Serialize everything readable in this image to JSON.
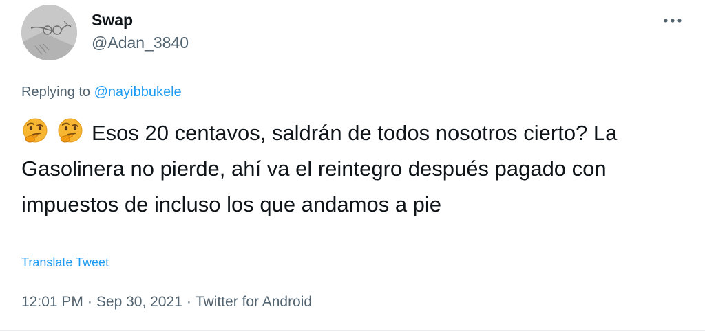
{
  "author": {
    "display_name": "Swap",
    "handle": "@Adan_3840",
    "avatar_icon": "avatar"
  },
  "more_icon": "ellipsis-icon",
  "reply_context": {
    "prefix": "Replying to ",
    "mention": "@nayibbukele"
  },
  "tweet": {
    "emojis": [
      "thinking-face-icon",
      "thinking-face-icon"
    ],
    "text": "Esos 20 centavos, saldrán de todos nosotros cierto? La Gasolinera no pierde, ahí va el reintegro después pagado con impuestos de incluso los que andamos a pie"
  },
  "translate_label": "Translate Tweet",
  "meta": {
    "time": "12:01 PM",
    "separator": "·",
    "date": "Sep 30, 2021",
    "source": "Twitter for Android"
  },
  "colors": {
    "link": "#1d9bf0",
    "secondary_text": "#536471",
    "primary_text": "#0f1419"
  }
}
